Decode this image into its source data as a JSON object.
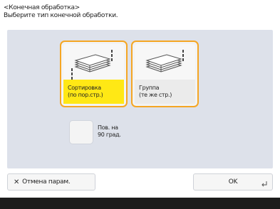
{
  "header": {
    "title": "<Конечная обработка>",
    "subtitle": "Выберите тип конечной обработки."
  },
  "options": [
    {
      "label": "Сортировка\n(по пор.стр.)",
      "selected": true,
      "icon": "sort-pages-icon"
    },
    {
      "label": "Группа\n(те же стр.)",
      "selected": true,
      "icon": "group-pages-icon"
    }
  ],
  "rotate": {
    "label": "Пов. на\n90 град.",
    "selected": false
  },
  "footer": {
    "cancel_label": "Отмена парам.",
    "ok_label": "OK"
  },
  "colors": {
    "selection_border": "#f5a623",
    "selected_label_bg": "#ffe815",
    "panel_bg": "#dde1ea"
  }
}
